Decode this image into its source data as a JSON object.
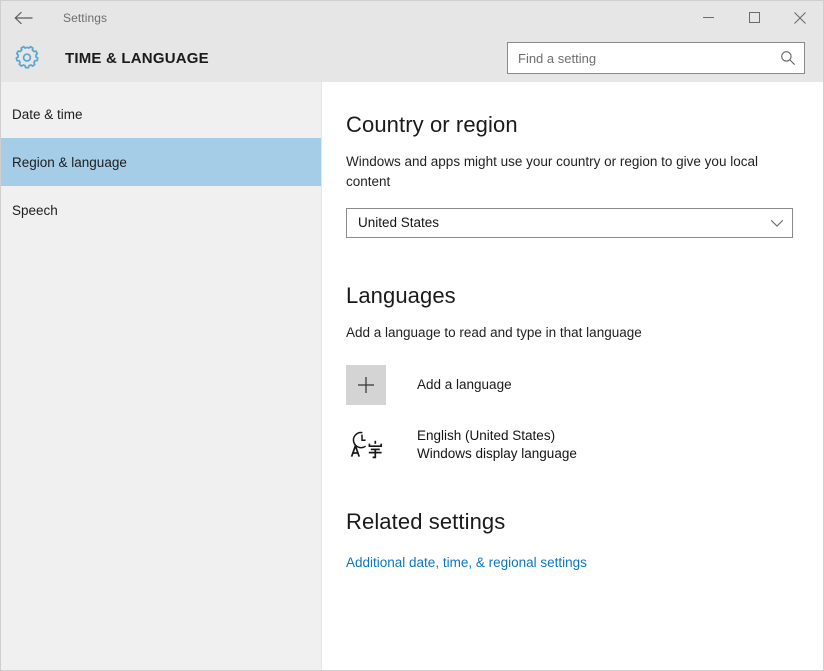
{
  "window": {
    "titlebar_title": "Settings",
    "back_icon": "back-arrow-icon",
    "controls": {
      "minimize": "minimize-icon",
      "maximize": "maximize-icon",
      "close": "close-icon"
    }
  },
  "header": {
    "gear_icon": "gear-icon",
    "page_title": "TIME & LANGUAGE",
    "accent_color": "#0c77bd"
  },
  "search": {
    "placeholder": "Find a setting",
    "value": "",
    "icon": "search-icon"
  },
  "sidebar": {
    "items": [
      {
        "label": "Date & time",
        "selected": false
      },
      {
        "label": "Region & language",
        "selected": true
      },
      {
        "label": "Speech",
        "selected": false
      }
    ],
    "selected_color": "#a5cde7",
    "background_color": "#f0f0f0"
  },
  "main": {
    "country": {
      "heading": "Country or region",
      "description": "Windows and apps might use your country or region to give you local content",
      "selected_value": "United States",
      "chevron_icon": "chevron-down-icon"
    },
    "languages": {
      "heading": "Languages",
      "description": "Add a language to read and type in that language",
      "add_label": "Add a language",
      "add_icon": "plus-icon",
      "installed": [
        {
          "icon": "language-translate-icon",
          "name": "English (United States)",
          "sub": "Windows display language"
        }
      ]
    },
    "related": {
      "heading": "Related settings",
      "link_label": "Additional date, time, & regional settings",
      "link_color": "#0c77bd"
    }
  }
}
